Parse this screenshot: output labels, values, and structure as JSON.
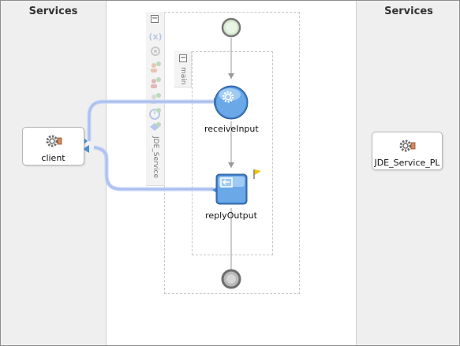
{
  "left_lane": {
    "title": "Services"
  },
  "right_lane": {
    "title": "Services"
  },
  "services": {
    "client": {
      "label": "client",
      "icon": "gear-icon"
    },
    "jde": {
      "label": "JDE_Service_PL",
      "icon": "gear-icon"
    }
  },
  "scopes": {
    "outer": {
      "label": "JDE_Service",
      "collapse_symbol": "−"
    },
    "main": {
      "label": "main",
      "collapse_symbol": "−"
    }
  },
  "activities": {
    "receive": {
      "label": "receiveInput",
      "icon": "gear-icon"
    },
    "reply": {
      "label": "replyOutput",
      "icon": "reply-icon"
    }
  },
  "toolbar_icons": [
    "variables-icon",
    "settings-icon",
    "partner-link-icon",
    "correlation-icon",
    "property-icon",
    "timer-icon",
    "event-icon"
  ],
  "colors": {
    "lane_bg": "#efefef",
    "connector": "#a9bff0",
    "activity_blue": "#4a8fd6",
    "flag": "#f2c200"
  }
}
